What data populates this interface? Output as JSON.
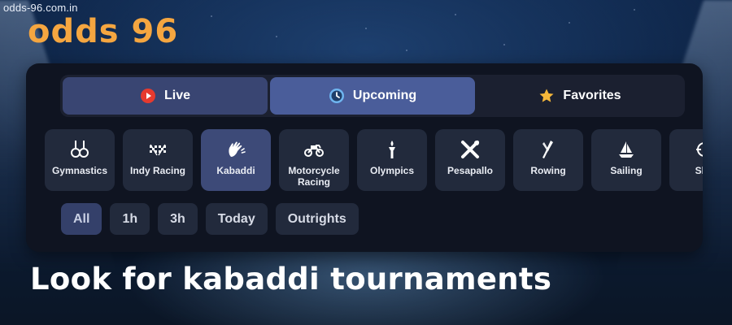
{
  "site": {
    "url": "odds-96.com.in",
    "logo": "odds 96"
  },
  "tabs": [
    {
      "label": "Live",
      "icon": "live-icon",
      "color": "#e63a2e"
    },
    {
      "label": "Upcoming",
      "icon": "clock-icon",
      "color": "#6fb5f0"
    },
    {
      "label": "Favorites",
      "icon": "star-icon",
      "color": "#f6b83a"
    }
  ],
  "active_tab": "Upcoming",
  "sports": [
    {
      "label": "Gymnastics",
      "icon": "gymnastics-rings-icon"
    },
    {
      "label": "Indy Racing",
      "icon": "checkered-flags-icon"
    },
    {
      "label": "Kabaddi",
      "icon": "kabaddi-hand-icon"
    },
    {
      "label": "Motorcycle\nRacing",
      "icon": "motorcycle-icon"
    },
    {
      "label": "Olympics",
      "icon": "torch-icon"
    },
    {
      "label": "Pesapallo",
      "icon": "crossed-bats-icon"
    },
    {
      "label": "Rowing",
      "icon": "oars-icon"
    },
    {
      "label": "Sailing",
      "icon": "sailboat-icon"
    },
    {
      "label": "Sho",
      "icon": "crosshair-icon"
    }
  ],
  "active_sport": "Kabaddi",
  "time_filters": [
    "All",
    "1h",
    "3h",
    "Today",
    "Outrights"
  ],
  "active_filter": "All",
  "caption": "Look for kabaddi tournaments",
  "colors": {
    "accent": "#f5a640",
    "panel": "#0f1421",
    "active_tab": "#4a5d9a"
  }
}
